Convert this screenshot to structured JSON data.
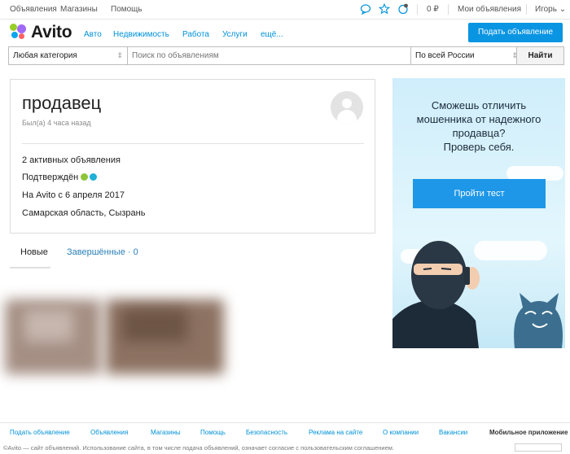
{
  "topbar": {
    "links": [
      "Объявления",
      "Магазины",
      "Помощь"
    ],
    "balance": "0 ₽",
    "my_ads": "Мои объявления",
    "user": "Игорь ⌄"
  },
  "header": {
    "logo_text": "Avito",
    "nav": [
      "Авто",
      "Недвижимость",
      "Работа",
      "Услуги",
      "ещё..."
    ],
    "post_button": "Подать объявление"
  },
  "search": {
    "category": "Любая категория",
    "placeholder": "Поиск по объявлениям",
    "region": "По всей России",
    "submit": "Найти"
  },
  "profile": {
    "name": "продавец",
    "last_seen": "Был(а) 4 часа назад",
    "active_ads": "2 активных объявления",
    "verified": "Подтверждён",
    "since": "На Avito с 6 апреля 2017",
    "location": "Самарская область, Сызрань"
  },
  "tabs": {
    "new": "Новые",
    "finished": "Завершённые · 0"
  },
  "ad": {
    "title_lines": [
      "Сможешь отличить",
      "мошенника от надежного",
      "продавца?",
      "Проверь себя."
    ],
    "button": "Пройти тест"
  },
  "footer": {
    "links": [
      "Подать объявление",
      "Объявления",
      "Магазины",
      "Помощь",
      "Безопасность",
      "Реклама на сайте",
      "О компании",
      "Вакансии",
      "Мобильное приложение"
    ],
    "note": "©Avito — сайт объявлений. Использование сайта, в том числе подача объявлений, означает согласие с пользовательским соглашением."
  },
  "colors": {
    "accent": "#0091d9",
    "button_blue": "#0a95e3",
    "logo_green": "#97cf26",
    "logo_blue": "#0aa6ee",
    "logo_red": "#ff6163",
    "logo_purple": "#a169f7"
  }
}
